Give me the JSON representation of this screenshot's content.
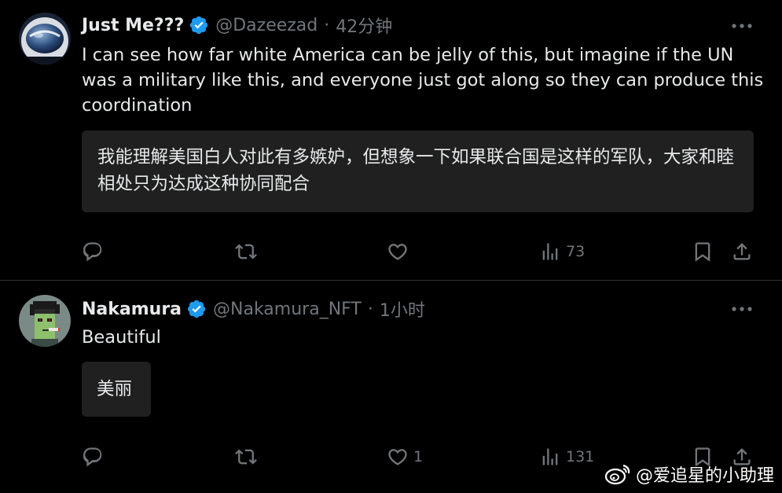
{
  "tweets": [
    {
      "display_name": "Just Me???",
      "handle": "@Dazeezad",
      "separator": "·",
      "time": "42分钟",
      "text": "I can see how far white America can be jelly of this, but imagine if the UN was a military like this, and everyone just got along so they can produce this coordination",
      "translation": "我能理解美国白人对此有多嫉妒，但想象一下如果联合国是这样的军队，大家和睦相处只为达成这种协同配合",
      "counts": {
        "reply": "",
        "retweet": "",
        "like": "",
        "views": "73"
      }
    },
    {
      "display_name": "Nakamura",
      "handle": "@Nakamura_NFT",
      "separator": "·",
      "time": "1小时",
      "text": "Beautiful",
      "translation": "美丽",
      "counts": {
        "reply": "",
        "retweet": "",
        "like": "1",
        "views": "131"
      }
    }
  ],
  "watermark": {
    "text": "@爱追星的小助理",
    "icon": "weibo-icon"
  },
  "colors": {
    "background": "#000000",
    "text_primary": "#e7e9ea",
    "text_secondary": "#71767b",
    "verified_blue": "#1d9bf0",
    "translation_bg": "#202020",
    "divider": "#2f3336"
  }
}
